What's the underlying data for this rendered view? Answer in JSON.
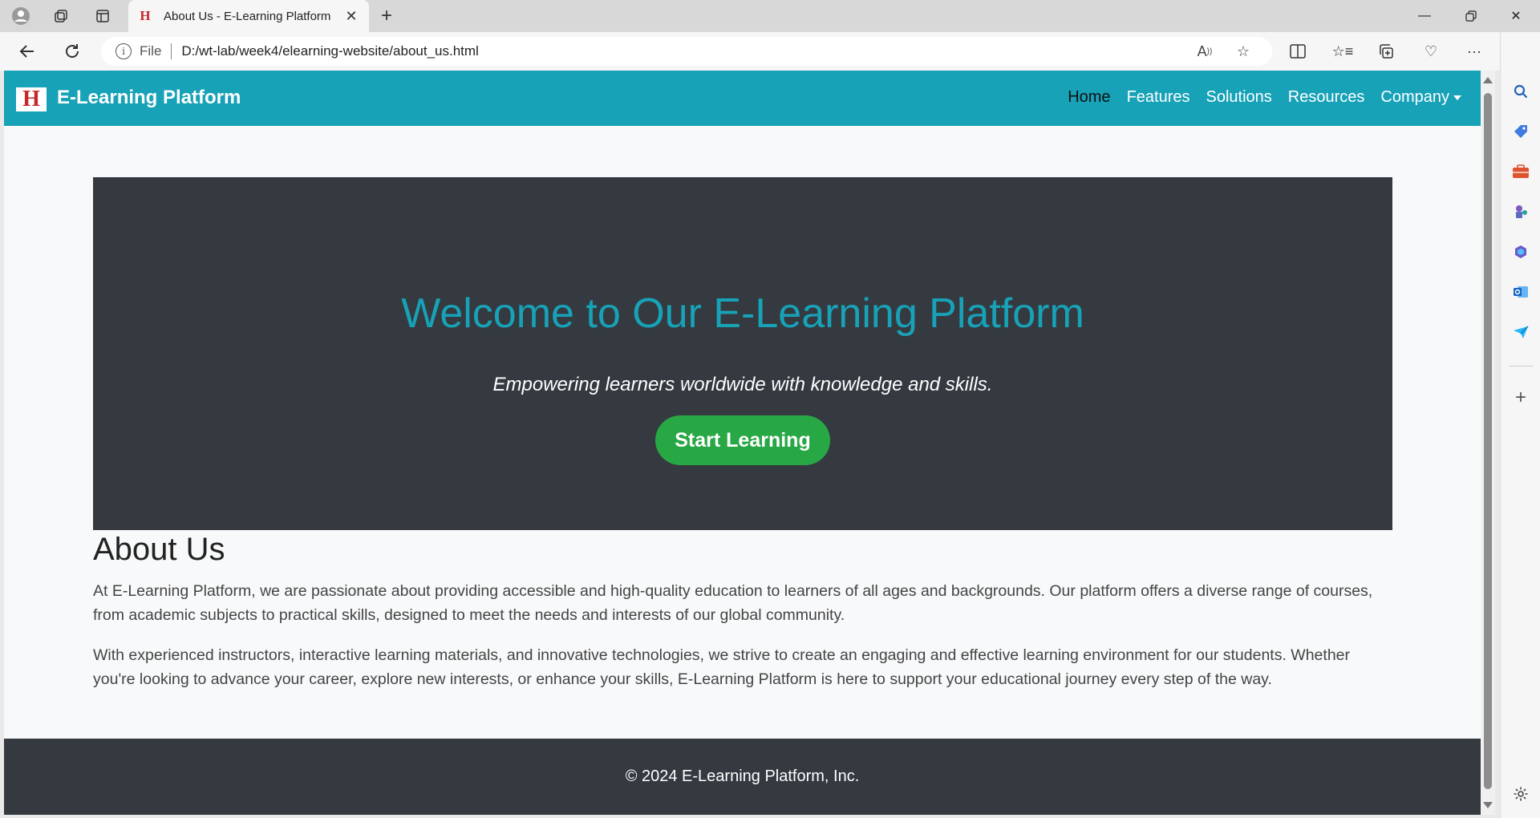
{
  "browser": {
    "tab_title": "About Us - E-Learning Platform",
    "tab_favicon_letter": "H",
    "address_scheme": "File",
    "address_url": "D:/wt-lab/week4/elearning-website/about_us.html"
  },
  "navbar": {
    "brand_logo_letter": "H",
    "brand": "E-Learning Platform",
    "links": [
      "Home",
      "Features",
      "Solutions",
      "Resources",
      "Company"
    ],
    "active": "Home"
  },
  "hero": {
    "title": "Welcome to Our E-Learning Platform",
    "subtitle": "Empowering learners worldwide with knowledge and skills.",
    "cta": "Start Learning"
  },
  "about": {
    "heading": "About Us",
    "paragraphs": [
      "At E-Learning Platform, we are passionate about providing accessible and high-quality education to learners of all ages and backgrounds. Our platform offers a diverse range of courses, from academic subjects to practical skills, designed to meet the needs and interests of our global community.",
      "With experienced instructors, interactive learning materials, and innovative technologies, we strive to create an engaging and effective learning environment for our students. Whether you're looking to advance your career, explore new interests, or enhance your skills, E-Learning Platform is here to support your educational journey every step of the way."
    ]
  },
  "footer": {
    "text": "© 2024 E-Learning Platform, Inc."
  },
  "colors": {
    "navbar": "#17a2b8",
    "hero_bg": "#343a40",
    "hero_title": "#17a2b8",
    "cta": "#28a745",
    "footer_bg": "#343a40"
  }
}
